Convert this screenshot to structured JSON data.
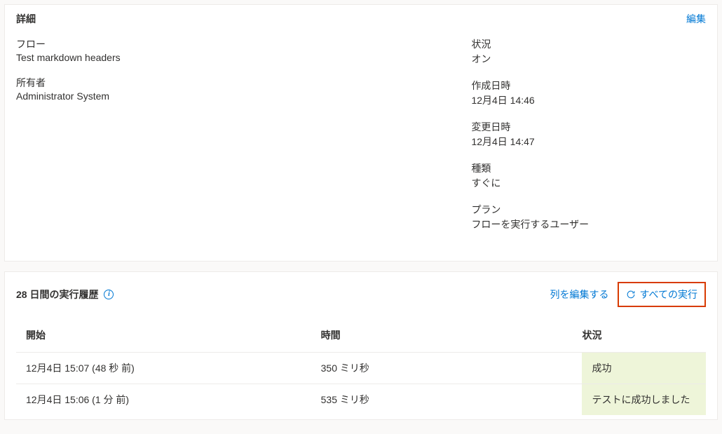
{
  "details": {
    "title": "詳細",
    "edit_label": "編集",
    "flow_label": "フロー",
    "flow_value": "Test markdown headers",
    "owner_label": "所有者",
    "owner_value": "Administrator System",
    "status_label": "状況",
    "status_value": "オン",
    "created_label": "作成日時",
    "created_value": "12月4日 14:46",
    "modified_label": "変更日時",
    "modified_value": "12月4日 14:47",
    "type_label": "種類",
    "type_value": "すぐに",
    "plan_label": "プラン",
    "plan_value": "フローを実行するユーザー"
  },
  "history": {
    "title": "28 日間の実行履歴",
    "edit_columns_label": "列を編集する",
    "all_runs_label": "すべての実行",
    "header_start": "開始",
    "header_duration": "時間",
    "header_status": "状況",
    "rows": [
      {
        "start": "12月4日 15:07 (48 秒 前)",
        "duration": "350 ミリ秒",
        "status": "成功"
      },
      {
        "start": "12月4日 15:06 (1 分 前)",
        "duration": "535 ミリ秒",
        "status": "テストに成功しました"
      }
    ]
  }
}
